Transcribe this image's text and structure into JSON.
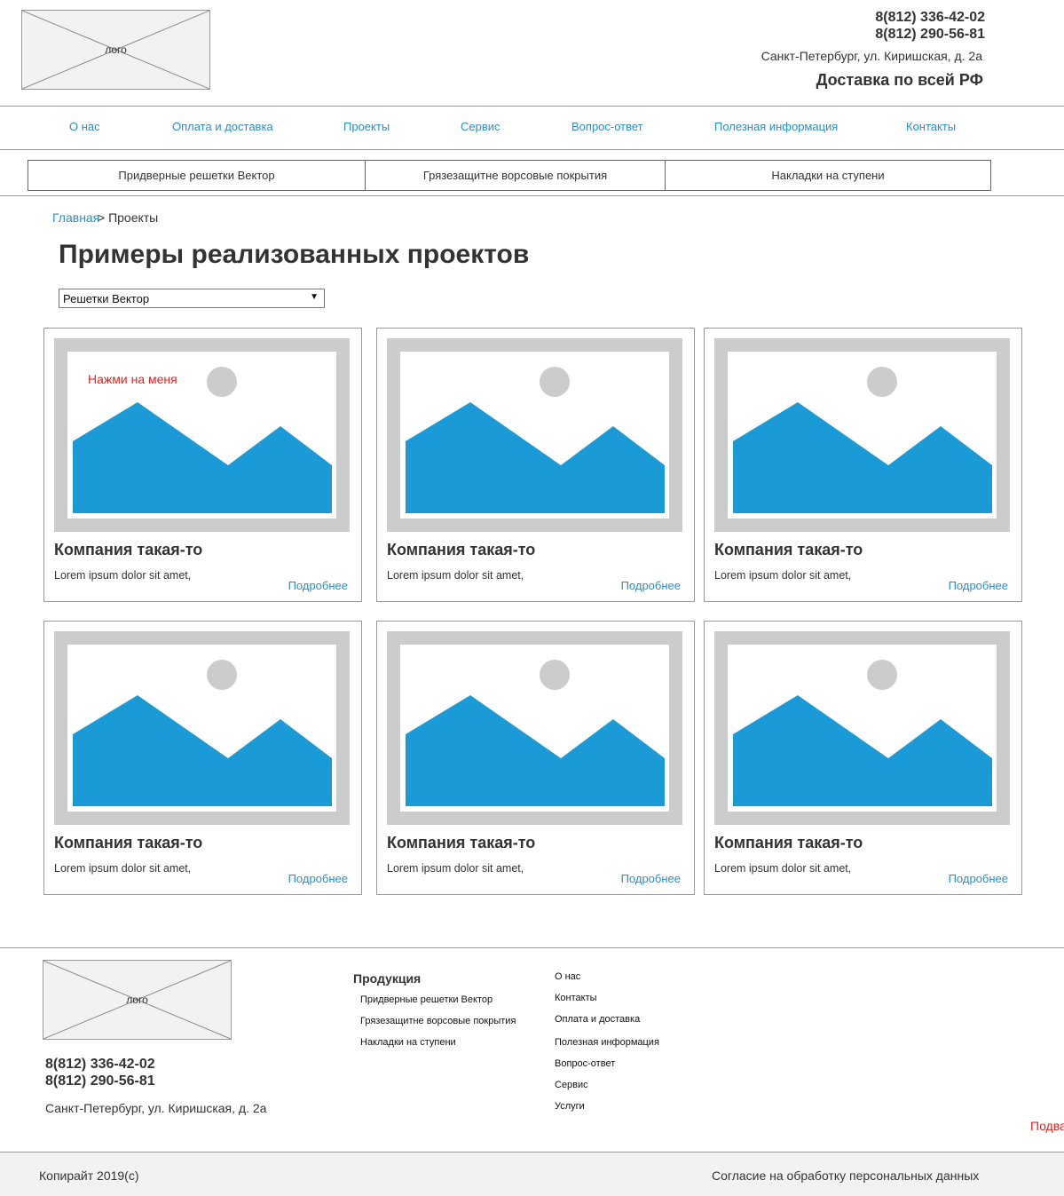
{
  "header": {
    "logo_label": "лого",
    "phone_1": "8(812) 336-42-02",
    "phone_2": "8(812) 290-56-81",
    "address": "Санкт-Петербург, ул. Киришская, д. 2а",
    "delivery": "Доставка по всей РФ"
  },
  "nav": {
    "items": [
      "О нас",
      "Оплата и доставка",
      "Проекты",
      "Сервис",
      "Вопрос-ответ",
      "Полезная информация",
      "Контакты"
    ]
  },
  "categories": [
    "Придверные решетки Вектор",
    "Грязезащитне ворсовые покрытия",
    "Накладки на ступени"
  ],
  "breadcrumb": {
    "home": "Главная",
    "current": "> Проекты"
  },
  "page_title": "Примеры реализованных проектов",
  "filter": {
    "selected": "Решетки Вектор"
  },
  "cards": [
    {
      "title": "Компания такая-то",
      "text": "Lorem ipsum dolor sit amet,",
      "more": "Подробнее",
      "hint": "Нажми на меня"
    },
    {
      "title": "Компания такая-то",
      "text": "Lorem ipsum dolor sit amet,",
      "more": "Подробнее"
    },
    {
      "title": "Компания такая-то",
      "text": "Lorem ipsum dolor sit amet,",
      "more": "Подробнее"
    },
    {
      "title": "Компания такая-то",
      "text": "Lorem ipsum dolor sit amet,",
      "more": "Подробнее"
    },
    {
      "title": "Компания такая-то",
      "text": "Lorem ipsum dolor sit amet,",
      "more": "Подробнее"
    },
    {
      "title": "Компания такая-то",
      "text": "Lorem ipsum dolor sit amet,",
      "more": "Подробнее"
    }
  ],
  "footer": {
    "logo_label": "лого",
    "phone_1": "8(812) 336-42-02",
    "phone_2": "8(812) 290-56-81",
    "address": "Санкт-Петербург, ул. Киришская, д. 2а",
    "products_heading": "Продукция",
    "products": [
      "Придверные решетки Вектор",
      "Грязезащитне ворсовые покрытия",
      "Накладки на ступени"
    ],
    "links": [
      "О нас",
      "Контакты",
      "Оплата и доставка",
      "Полезная информация",
      "Вопрос-ответ",
      "Сервис",
      "Услуги"
    ],
    "edge_text": "Подва",
    "copyright": "Копирайт 2019(c)",
    "consent": "Согласие на обработку персональных данных"
  },
  "colors": {
    "link": "#2a8ec6",
    "image_fill": "#1a9bd7",
    "image_frame": "#cccccc",
    "hint": "#e8201d"
  }
}
